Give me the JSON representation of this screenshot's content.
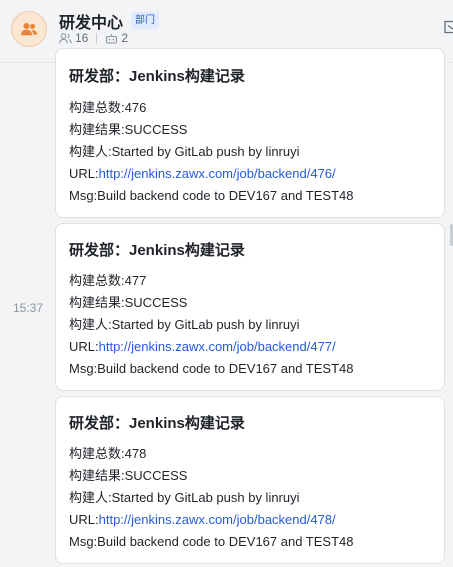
{
  "header": {
    "title": "研发中心",
    "tag": "部门",
    "member_count": "16",
    "bot_count": "2"
  },
  "timestamp": "15:37",
  "messages": [
    {
      "title": "研发部：Jenkins构建记录",
      "build_no_label": "构建总数:",
      "build_no": "476",
      "result_label": "构建结果:",
      "result": "SUCCESS",
      "builder_label": "构建人:",
      "builder": "Started by GitLab push by linruyi",
      "url_label": "URL:",
      "url": "http://jenkins.zawx.com/job/backend/476/",
      "msg_label": "Msg:",
      "msg": "Build backend code to DEV167 and TEST48"
    },
    {
      "title": "研发部：Jenkins构建记录",
      "build_no_label": "构建总数:",
      "build_no": "477",
      "result_label": "构建结果:",
      "result": "SUCCESS",
      "builder_label": "构建人:",
      "builder": "Started by GitLab push by linruyi",
      "url_label": "URL:",
      "url": "http://jenkins.zawx.com/job/backend/477/",
      "msg_label": "Msg:",
      "msg": "Build backend code to DEV167 and TEST48"
    },
    {
      "title": "研发部：Jenkins构建记录",
      "build_no_label": "构建总数:",
      "build_no": "478",
      "result_label": "构建结果:",
      "result": "SUCCESS",
      "builder_label": "构建人:",
      "builder": "Started by GitLab push by linruyi",
      "url_label": "URL:",
      "url": "http://jenkins.zawx.com/job/backend/478/",
      "msg_label": "Msg:",
      "msg": "Build backend code to DEV167 and TEST48"
    }
  ],
  "colors": {
    "link": "#245bdb",
    "tag_bg": "#e1eaff",
    "avatar_bg": "#fbe6d2",
    "avatar_icon": "#e8833a"
  },
  "icons": {
    "avatar": "group-icon",
    "members": "members-icon",
    "bots": "bot-icon",
    "edge": "open-panel-icon"
  }
}
